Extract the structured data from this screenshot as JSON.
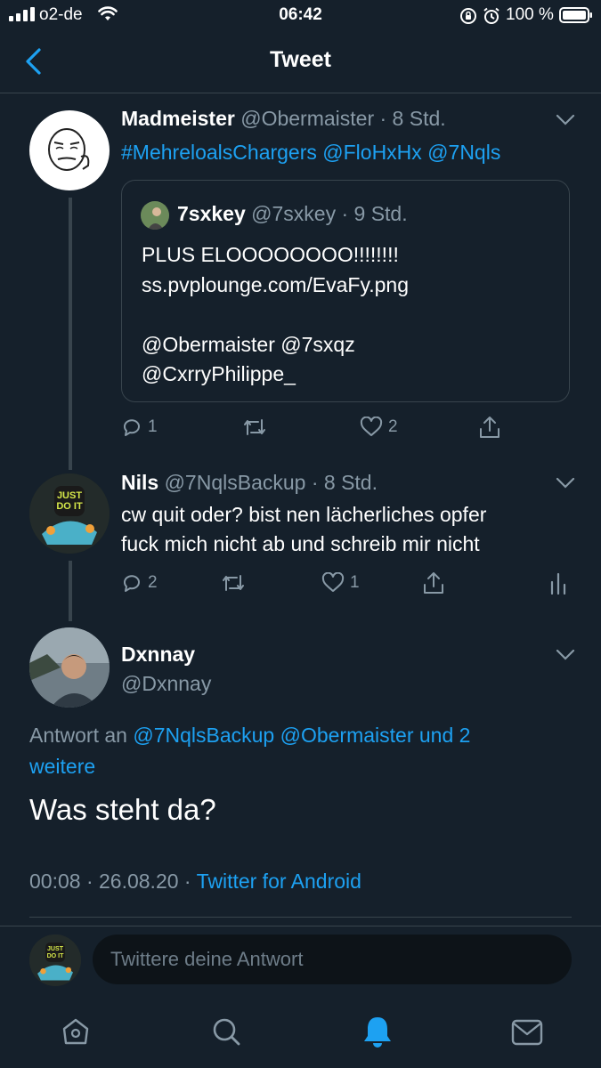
{
  "status_bar": {
    "carrier": "o2-de",
    "time": "06:42",
    "battery": "100 %"
  },
  "nav": {
    "title": "Tweet",
    "back_icon": "chevron-left-icon"
  },
  "tweets": [
    {
      "name": "Madmeister",
      "handle": "@Obermaister",
      "time": "· 8 Std.",
      "text": "#MehreloalsChargers @FloHxHx @7Nqls",
      "quote": {
        "name": "7sxkey",
        "handle": "@7sxkey",
        "time": "· 9 Std.",
        "line1": "PLUS ELOOOOOOOO!!!!!!!!",
        "line2": "ss.pvplounge.com/EvaFy.png",
        "line3": "@Obermaister @7sxqz",
        "line4": "@CxrryPhilippe_"
      },
      "actions": {
        "replies": "1",
        "retweets": "",
        "likes": "2"
      }
    },
    {
      "name": "Nils",
      "handle": "@7NqlsBackup",
      "time": "· 8 Std.",
      "line1": "cw quit oder? bist nen lächerliches opfer",
      "line2": "fuck mich nicht ab und schreib mir nicht",
      "actions": {
        "replies": "2",
        "retweets": "",
        "likes": "1"
      }
    }
  ],
  "main_tweet": {
    "name": "Dxnnay",
    "handle": "@Dxnnay",
    "reply_prefix": "Antwort an",
    "reply_to": "@7NqlsBackup @Obermaister und 2",
    "reply_to_more": "weitere",
    "text": "Was steht da?",
    "meta_time": "00:08 · 26.08.20 ·",
    "meta_source": "Twitter for Android"
  },
  "reply_box": {
    "placeholder": "Twittere deine Antwort"
  },
  "tab_bar": {
    "items": [
      "home-icon",
      "search-icon",
      "notifications-icon",
      "messages-icon"
    ],
    "active": "notifications-icon"
  },
  "colors": {
    "background": "#15202b",
    "accent": "#1da1f2",
    "secondary_text": "#8899a6",
    "border": "#38444d"
  }
}
